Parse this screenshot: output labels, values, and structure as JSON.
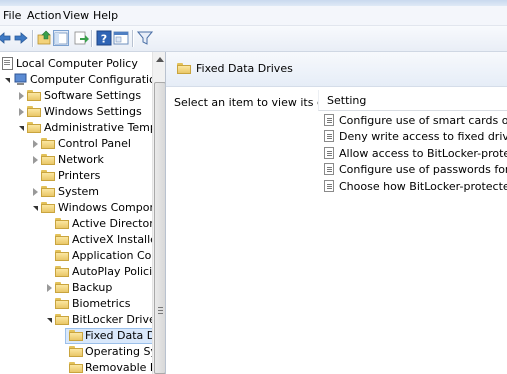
{
  "menubar": {
    "items": [
      "File",
      "Action",
      "View",
      "Help"
    ]
  },
  "toolbar": {
    "icons": [
      "back-arrow-icon",
      "forward-arrow-icon",
      "up-folder-icon",
      "show-hide-tree-icon",
      "export-list-icon",
      "help-icon",
      "properties-icon",
      "filter-icon"
    ]
  },
  "tree": {
    "items": [
      {
        "label": "Local Computer Policy"
      },
      {
        "label": "Computer Configuration"
      },
      {
        "label": "Software Settings"
      },
      {
        "label": "Windows Settings"
      },
      {
        "label": "Administrative Templates"
      },
      {
        "label": "Control Panel"
      },
      {
        "label": "Network"
      },
      {
        "label": "Printers"
      },
      {
        "label": "System"
      },
      {
        "label": "Windows Components"
      },
      {
        "label": "Active Directory Feder"
      },
      {
        "label": "ActiveX Installer Servic"
      },
      {
        "label": "Application Compatib"
      },
      {
        "label": "AutoPlay Policies"
      },
      {
        "label": "Backup"
      },
      {
        "label": "Biometrics"
      },
      {
        "label": "BitLocker Drive Encryp"
      },
      {
        "label": "Fixed Data Drives"
      },
      {
        "label": "Operating System"
      },
      {
        "label": "Removable Data D"
      }
    ]
  },
  "details": {
    "title": "Fixed Data Drives",
    "description": "Select an item to view its description.",
    "column_header": "Setting",
    "settings": [
      "Configure use of smart cards on fixed data d",
      "Deny write access to fixed drives not protecte",
      "Allow access to BitLocker-protected fixed dat",
      "Configure use of passwords for fixed data dri",
      "Choose how BitLocker-protected fixed drives"
    ]
  }
}
